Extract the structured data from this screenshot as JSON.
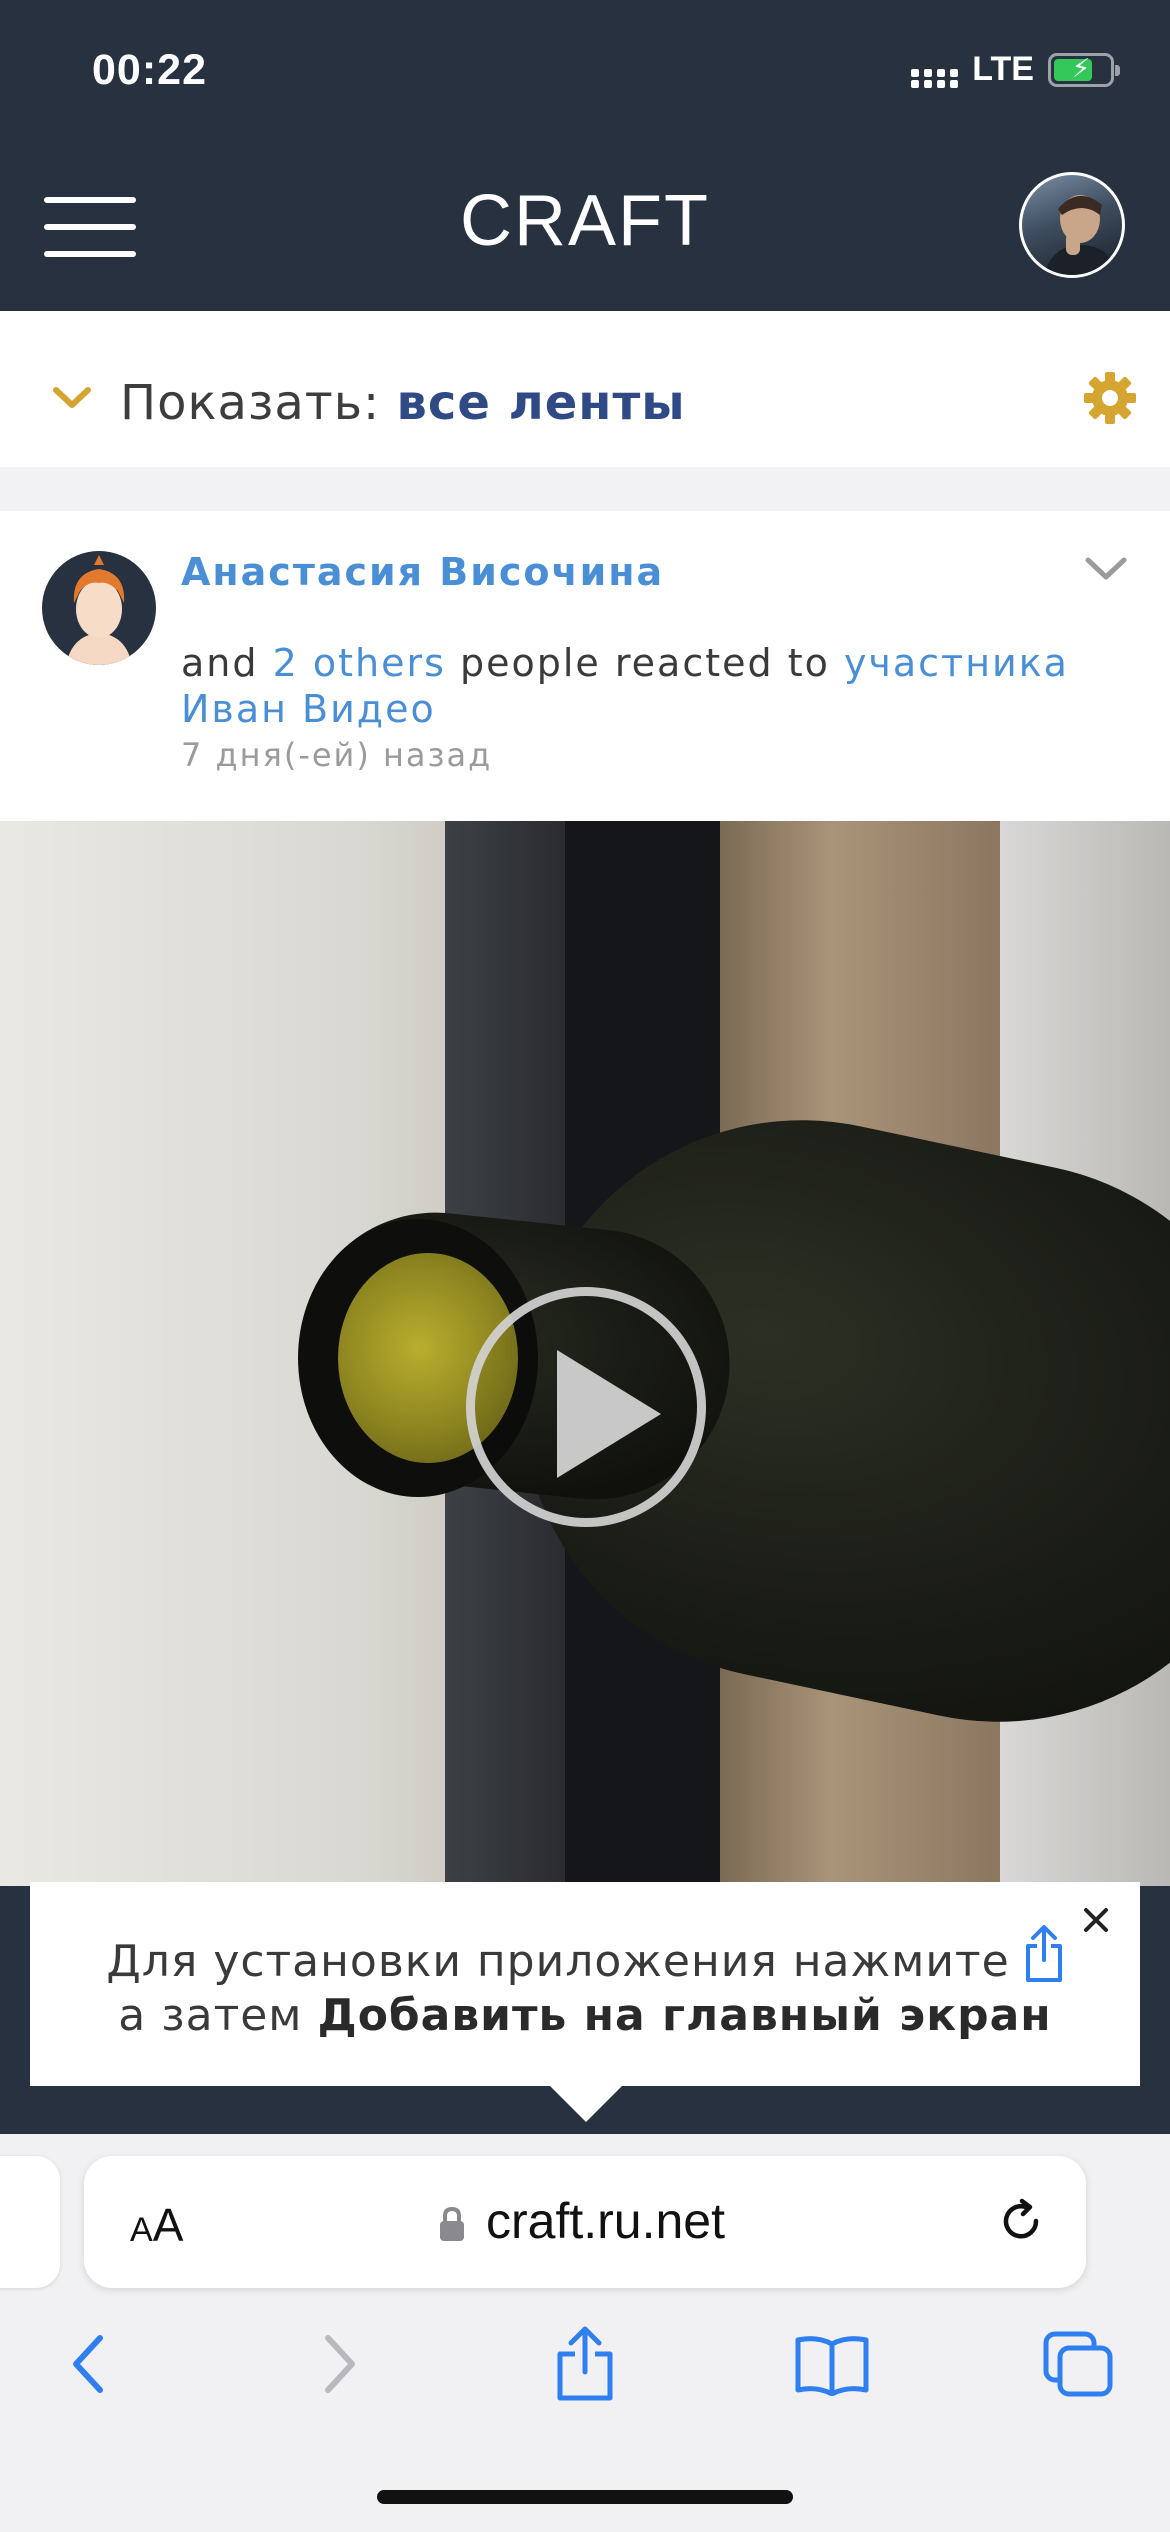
{
  "status_bar": {
    "time": "00:22",
    "network": "LTE",
    "battery_level": 0.6,
    "battery_charging": true
  },
  "header": {
    "title": "CRAFT",
    "menu_icon": "hamburger-icon",
    "avatar_icon": "user-avatar"
  },
  "filter": {
    "label": "Показать:",
    "value": "все ленты",
    "chevron_icon": "chevron-down-icon",
    "settings_icon": "gear-icon"
  },
  "post": {
    "author": "Анастасия Височина",
    "text_and": "and",
    "text_others": "2 others",
    "text_reacted": "people reacted to",
    "text_target": "участника Иван Видео",
    "time": "7 дня(-ей) назад",
    "menu_icon": "chevron-down-icon"
  },
  "video": {
    "play_icon": "play-icon"
  },
  "install_banner": {
    "line1": "Для установки приложения нажмите",
    "line2_prefix": "а затем",
    "line2_bold": "Добавить на главный экран",
    "share_icon": "share-icon",
    "close_icon": "close-icon"
  },
  "browser": {
    "text_size_small": "A",
    "text_size_big": "A",
    "url": "craft.ru.net",
    "lock_icon": "lock-icon",
    "reload_icon": "reload-icon",
    "toolbar_icons": [
      "back-icon",
      "forward-icon",
      "share-icon",
      "bookmarks-icon",
      "tabs-icon"
    ]
  },
  "colors": {
    "header_bg": "#27313f",
    "accent_gold": "#d6a531",
    "link_blue": "#4a8fd6",
    "filter_value": "#2f4a85",
    "ios_blue": "#2f7ff0"
  }
}
